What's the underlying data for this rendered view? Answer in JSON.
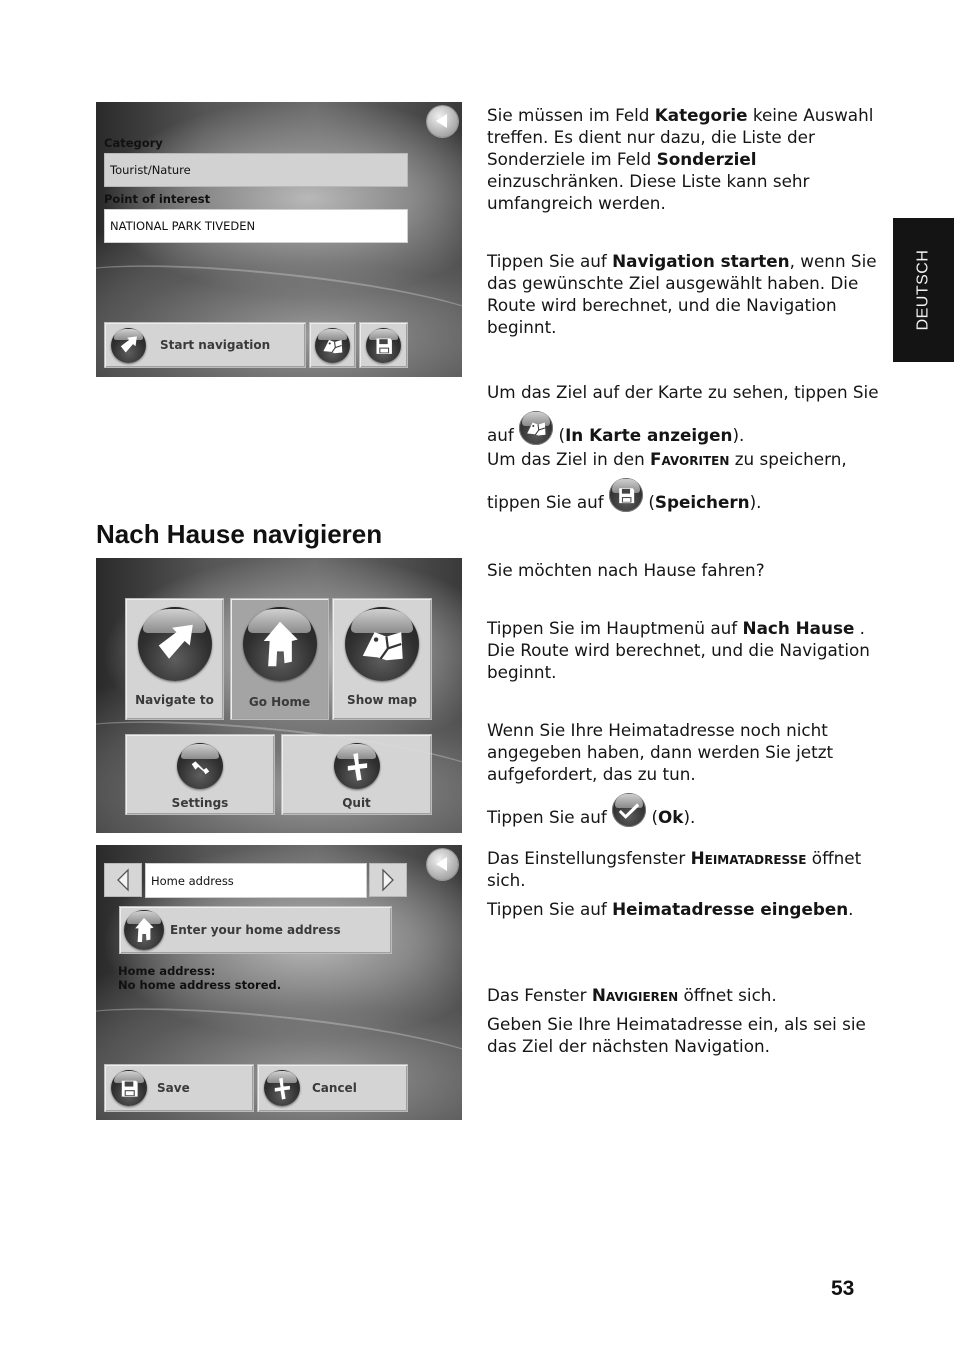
{
  "side_tab": {
    "label": "DEUTSCH"
  },
  "page_number": "53",
  "section_heading": "Nach Hause navigieren",
  "screens": {
    "poi": {
      "category_label": "Category",
      "category_value": "Tourist/Nature",
      "poi_label": "Point of interest",
      "poi_value": "NATIONAL PARK TIVEDEN",
      "start_navigation": "Start navigation",
      "icons": {
        "back": "back-arrow-icon",
        "start": "navigate-arrow-icon",
        "map": "map-icon",
        "save": "floppy-disk-icon"
      }
    },
    "main_menu": {
      "tiles": [
        {
          "label": "Navigate to",
          "icon": "navigate-arrow-icon",
          "active": false
        },
        {
          "label": "Go Home",
          "icon": "house-icon",
          "active": true
        },
        {
          "label": "Show map",
          "icon": "map-icon",
          "active": false
        },
        {
          "label": "Settings",
          "icon": "wrench-icon",
          "active": false
        },
        {
          "label": "Quit",
          "icon": "close-x-icon",
          "active": false
        }
      ]
    },
    "home_address": {
      "title_field": "Home address",
      "enter_button": "Enter your home address",
      "status_line1": "Home address:",
      "status_line2": "No home address stored.",
      "save": "Save",
      "cancel": "Cancel"
    }
  },
  "paragraphs": {
    "p1": {
      "a": "Sie müssen im Feld ",
      "b1": "Kategorie",
      "c": " keine Auswahl treffen. Es dient nur dazu, die Liste der Sonderziele im Feld ",
      "b2": "Sonderziel",
      "d": " einzuschränken. Diese Liste kann sehr umfangreich werden."
    },
    "p2": {
      "a": "Tippen Sie auf ",
      "b": "Navigation starten",
      "c": ", wenn Sie das gewünschte Ziel ausgewählt haben. Die Route wird berechnet, und die Navigation beginnt."
    },
    "p3": {
      "a": "Um das Ziel auf der Karte zu sehen, tippen Sie auf ",
      "paren_open": " (",
      "b": "In Karte anzeigen",
      "paren_close": ")."
    },
    "p4": {
      "a": "Um das Ziel in den ",
      "sc": "Favoriten",
      "c": " zu speichern, tippen Sie auf ",
      "paren_open": " (",
      "b": "Speichern",
      "paren_close": ")."
    },
    "p5": {
      "text": "Sie möchten nach Hause fahren?"
    },
    "p6": {
      "a": "Tippen Sie im Hauptmenü auf ",
      "b": "Nach Hause",
      "c": " . Die Route wird berechnet, und die Navigation beginnt."
    },
    "p7": {
      "text": "Wenn Sie Ihre Heimatadresse noch nicht angegeben haben, dann werden Sie jetzt aufgefordert, das zu tun."
    },
    "p8": {
      "a": "Tippen Sie auf ",
      "paren_open": " (",
      "b": "Ok",
      "paren_close": ")."
    },
    "p9": {
      "a": "Das Einstellungsfenster ",
      "sc": "Heimatadresse",
      "c": " öffnet sich."
    },
    "p10": {
      "a": "Tippen Sie auf ",
      "b": "Heimatadresse eingeben",
      "c": "."
    },
    "p11": {
      "a": "Das Fenster ",
      "sc": "Navigieren",
      "c": " öffnet sich."
    },
    "p12": {
      "text": "Geben Sie Ihre Heimatadresse ein, als sei sie das Ziel der nächsten Navigation."
    }
  },
  "inline_icons": {
    "map": "map-icon",
    "save": "floppy-disk-icon",
    "ok": "checkmark-icon"
  }
}
